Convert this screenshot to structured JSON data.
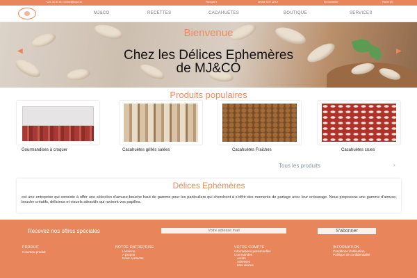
{
  "topbar": {
    "contact": "+221 33 00 33 / contact@mjco.sn",
    "lang": "Français ▾",
    "currency": "Devise XOF CFA ▾",
    "login": "Se connecter",
    "cart": "Panier (0)"
  },
  "nav": {
    "items": [
      "MJ&CO",
      "RECETTES",
      "CACAHUETES",
      "BOUTIQUE",
      "SERVICES"
    ]
  },
  "hero": {
    "welcome": "Bienvenue",
    "title_line1": "Chez les Délices Ephemères",
    "title_line2": "de MJ&CO"
  },
  "popular": {
    "title": "Produits populaires",
    "products": [
      {
        "label": "Gourmandises à croquer"
      },
      {
        "label": "Cacahuètes grillés salées"
      },
      {
        "label": "Cacahuètes Fraiches"
      },
      {
        "label": "Cacahuètes crues"
      }
    ],
    "all_products": "Tous les produits",
    "arrow": "›"
  },
  "about": {
    "title": "Délices Ephémères",
    "text": "est une entreprise qui consiste à offrir une sélection d'amuse-bouche haut de gamme pour les particuliers qui cherchent à s'offrir des moments de partage avec leur entourage. Nous proposons une gamme d'amuse-bouche créatifs, délicieux et visuels attractifs qui raviront vos papilles."
  },
  "newsletter": {
    "label": "Recevez nos offres spéciales",
    "placeholder": "Votre adresse mail",
    "button": "S'abonner"
  },
  "footer": {
    "col1_title": "PRODUIT",
    "col1_items": [
      "Nouveau produit"
    ],
    "col2_title": "NOTRE ENTREPRISE",
    "col2_items": [
      "Livraison",
      "A propos",
      "Nous contacter"
    ],
    "col3_title": "VOTRE COMPTE",
    "col3_items": [
      "Informations personnelles",
      "Commandes",
      "Avoirs",
      "Adresses",
      "Mes alertes"
    ],
    "col4_title": "INFORMATION",
    "col4_items": [
      "Conditions d'utilisation",
      "Politique de confidentialité"
    ]
  },
  "colors": {
    "accent": "#e8855a",
    "title": "#ee8b5c"
  }
}
